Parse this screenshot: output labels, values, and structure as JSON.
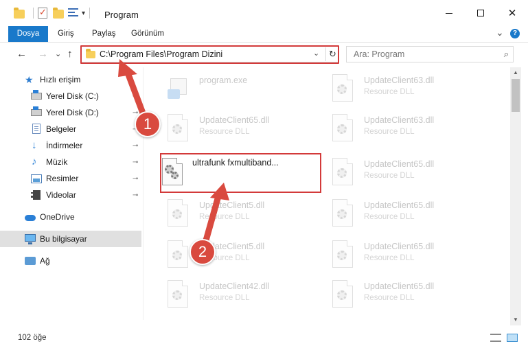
{
  "window": {
    "title": "Program",
    "minimize": "—",
    "close": "✕"
  },
  "ribbon": {
    "tabs": [
      "Dosya",
      "Giriş",
      "Paylaş",
      "Görünüm"
    ],
    "expand": "⌄",
    "help": "?"
  },
  "address": {
    "path": "C:\\Program Files\\Program Dizini",
    "dropdown": "⌄",
    "refresh": "↻"
  },
  "nav": {
    "back": "←",
    "forward": "→",
    "recent": "⌄",
    "up": "↑"
  },
  "search": {
    "placeholder": "Ara: Program",
    "icon": "⌕"
  },
  "sidebar": {
    "items": [
      {
        "label": "Hızlı erişim",
        "icon": "star-icon"
      },
      {
        "label": "Yerel Disk (C:)",
        "icon": "drive-icon"
      },
      {
        "label": "Yerel Disk (D:)",
        "icon": "drive-icon"
      },
      {
        "label": "Belgeler",
        "icon": "documents-icon"
      },
      {
        "label": "İndirmeler",
        "icon": "download-icon"
      },
      {
        "label": "Müzik",
        "icon": "music-icon"
      },
      {
        "label": "Resimler",
        "icon": "pictures-icon"
      },
      {
        "label": "Videolar",
        "icon": "videos-icon"
      },
      {
        "label": "OneDrive",
        "icon": "cloud-icon"
      },
      {
        "label": "Bu bilgisayar",
        "icon": "computer-icon"
      },
      {
        "label": "Ağ",
        "icon": "network-icon"
      }
    ],
    "pin": "📌"
  },
  "files": [
    {
      "name": "program.exe",
      "type": "",
      "icon": "exe-icon"
    },
    {
      "name": "UpdateClient63.dll",
      "type": "Resource DLL",
      "icon": "dll-icon"
    },
    {
      "name": "UpdateClient65.dll",
      "type": "Resource DLL",
      "icon": "dll-icon"
    },
    {
      "name": "UpdateClient63.dll",
      "type": "Resource DLL",
      "icon": "dll-icon"
    },
    {
      "name": "ultrafunk fxmultiband...",
      "type": "",
      "icon": "dll-icon"
    },
    {
      "name": "UpdateClient65.dll",
      "type": "Resource DLL",
      "icon": "dll-icon"
    },
    {
      "name": "UpdateClient5.dll",
      "type": "Resource DLL",
      "icon": "dll-icon"
    },
    {
      "name": "UpdateClient65.dll",
      "type": "Resource DLL",
      "icon": "dll-icon"
    },
    {
      "name": "UpdateClient5.dll",
      "type": "Resource DLL",
      "icon": "dll-icon"
    },
    {
      "name": "UpdateClient65.dll",
      "type": "Resource DLL",
      "icon": "dll-icon"
    },
    {
      "name": "UpdateClient42.dll",
      "type": "Resource DLL",
      "icon": "dll-icon"
    },
    {
      "name": "UpdateClient65.dll",
      "type": "Resource DLL",
      "icon": "dll-icon"
    }
  ],
  "status": {
    "count": "102 öğe"
  },
  "annotations": {
    "step1": "1",
    "step2": "2",
    "color": "#d33a3a"
  }
}
